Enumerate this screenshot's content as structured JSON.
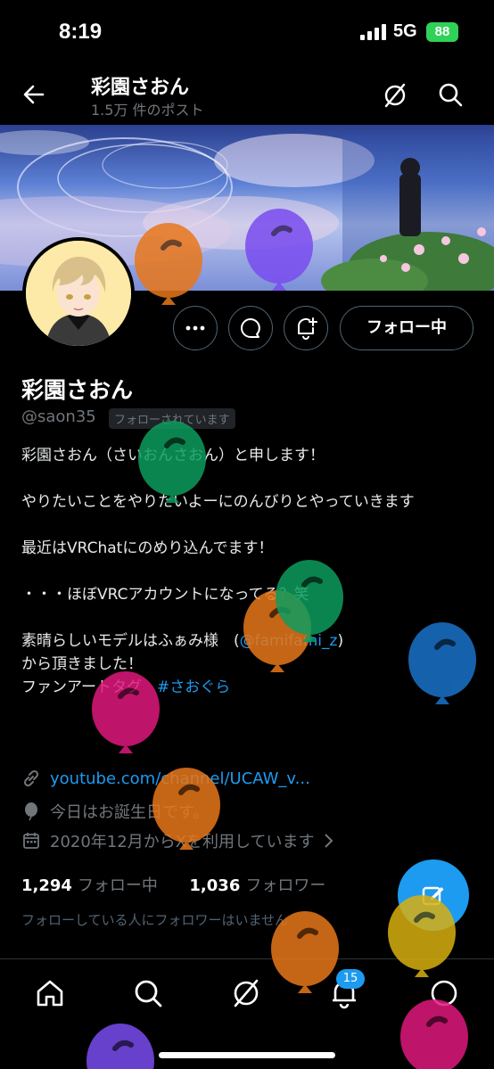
{
  "status": {
    "time": "8:19",
    "network": "5G",
    "battery": "88"
  },
  "header": {
    "title": "彩園さおん",
    "posts": "1.5万 件のポスト"
  },
  "actions": {
    "follow_label": "フォロー中"
  },
  "profile": {
    "name": "彩園さおん",
    "handle": "@saon35",
    "follows_you": "フォローされています",
    "bio": {
      "line1": "彩園さおん（さいおんさおん）と申します！",
      "line2": "やりたいことをやりたいよーにのんびりとやっていきます",
      "line3": "最近はVRChatにのめり込んでます！",
      "line4": "・・・ほぼVRCアカウントになってる？笑",
      "line5_prefix": "素晴らしいモデルはふぁみ様　(",
      "line5_mention": "@famifami_z",
      "line5_suffix": ")",
      "line6": "から頂きました！",
      "line7_prefix": "ファンアートタグ　",
      "line7_tag": "#さおぐら"
    },
    "website": "youtube.com/channel/UCAW_v...",
    "birthday": "今日はお誕生日です。",
    "joined": "2020年12月からXを利用しています",
    "following_count": "1,294",
    "following_label": "フォロー中",
    "followers_count": "1,036",
    "followers_label": "フォロワー",
    "followed_note": "フォローしている人にフォロワーはいません"
  },
  "tabbar": {
    "notifications_badge": "15"
  },
  "colors": {
    "accent": "#1d9bf0",
    "background": "#000000",
    "muted": "#71767b"
  },
  "balloons": [
    {
      "color": "#e8771a"
    },
    {
      "color": "#7a4cf0"
    },
    {
      "color": "#0e9d5e"
    },
    {
      "color": "#e8771a"
    },
    {
      "color": "#0e9d5e"
    },
    {
      "color": "#1a73c9"
    },
    {
      "color": "#e0187d"
    },
    {
      "color": "#e8771a"
    },
    {
      "color": "#e8771a"
    },
    {
      "color": "#d8b010"
    },
    {
      "color": "#e0187d"
    },
    {
      "color": "#7a4cf0"
    }
  ]
}
